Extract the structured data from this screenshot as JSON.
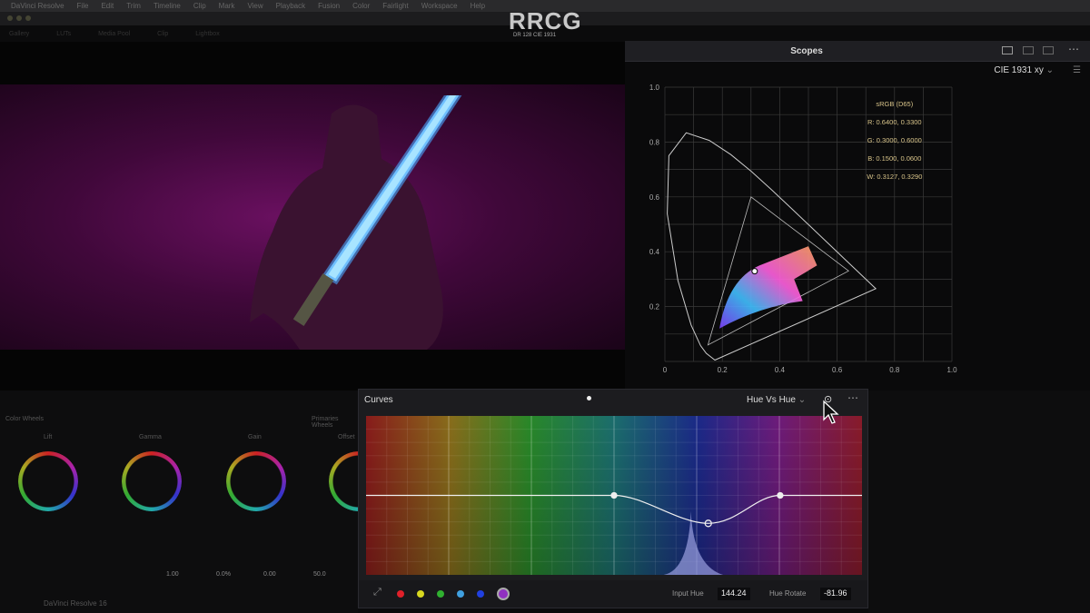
{
  "menubar": {
    "items": [
      "DaVinci Resolve",
      "File",
      "Edit",
      "Trim",
      "Timeline",
      "Clip",
      "Mark",
      "View",
      "Playback",
      "Fusion",
      "Color",
      "Fairlight",
      "Workspace",
      "Help"
    ]
  },
  "toolbar": {
    "items": [
      "Gallery",
      "LUTs",
      "Media Pool",
      "Clip",
      "Lightbox"
    ]
  },
  "watermark": {
    "logo": "RRCG",
    "sub": "DR 128 CIE 1931"
  },
  "scopes": {
    "title": "Scopes",
    "mode": "CIE 1931 xy",
    "gamut": {
      "name": "sRGB (D65)",
      "R": [
        0.64,
        0.33
      ],
      "G": [
        0.3,
        0.6
      ],
      "B": [
        0.15,
        0.06
      ],
      "W": [
        0.3127,
        0.329
      ],
      "labels": [
        "sRGB (D65)",
        "R: 0.6400, 0.3300",
        "G: 0.3000, 0.6000",
        "B: 0.1500, 0.0600",
        "W: 0.3127, 0.3290"
      ]
    },
    "y_ticks": [
      "1.0",
      "0.8",
      "0.6",
      "0.4",
      "0.2"
    ],
    "x_ticks": [
      "0",
      "0.2",
      "0.4",
      "0.6",
      "0.8",
      "1.0"
    ]
  },
  "wheels": {
    "title": "Color Wheels",
    "right_title": "Primaries Wheels",
    "labels": [
      "Lift",
      "Gamma",
      "Gain",
      "Offset"
    ],
    "values": [
      "1.00",
      "0.0%",
      "0.00",
      "50.0"
    ]
  },
  "curves": {
    "title": "Curves",
    "mode": "Hue Vs Hue",
    "input_hue_label": "Input Hue",
    "input_hue": "144.24",
    "hue_rotate_label": "Hue Rotate",
    "hue_rotate": "-81.96",
    "swatch_colors": [
      "#e0202a",
      "#d8d820",
      "#30b030",
      "#40a0e0",
      "#2040e0",
      "#9030c0"
    ],
    "points": [
      [
        0.5,
        0
      ],
      [
        0.69,
        -0.22
      ],
      [
        0.835,
        0
      ]
    ]
  },
  "footer": {
    "app": "DaVinci Resolve 16"
  }
}
